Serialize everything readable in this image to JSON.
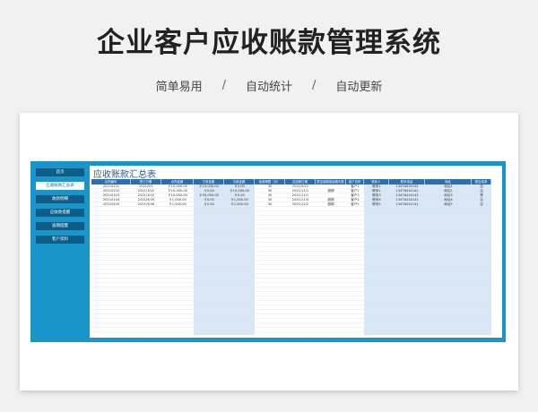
{
  "page": {
    "title": "企业客户应收账款管理系统",
    "subtitle": [
      "简单易用",
      "自动统计",
      "自动更新"
    ],
    "separator": "/"
  },
  "sidebar": {
    "items": [
      {
        "label": "首页",
        "active": false
      },
      {
        "label": "应收账款汇总表",
        "active": true
      },
      {
        "label": "收款明细",
        "active": false
      },
      {
        "label": "应收款提醒",
        "active": false
      },
      {
        "label": "逾期提醒",
        "active": false
      },
      {
        "label": "客户资料",
        "active": false
      }
    ]
  },
  "sheet": {
    "title": "应收账款汇总表",
    "columns": [
      "合同编号",
      "签订日期",
      "合同金额",
      "已收金额",
      "欠款金额",
      "信用期限（天）",
      "应还款日期",
      "是否逾期或逾期天数",
      "客户名称",
      "联系人",
      "联系电话",
      "地址",
      "是否结清"
    ],
    "rows": [
      [
        "20210101",
        "2021/9/1",
        "￥10,000.00",
        "￥10,000.00",
        "￥0.00",
        "30",
        "2021/9/21",
        "",
        "客户1",
        "联系1",
        "13478414144",
        "地址1",
        "否"
      ],
      [
        "20210102",
        "2021/10/2",
        "￥10,000.00",
        "￥0.00",
        "￥10,000.00",
        "30",
        "2021/11/1",
        "超期",
        "客户2",
        "联系2",
        "13478414142",
        "地址2",
        "否"
      ],
      [
        "20210103",
        "2021/10/2",
        "￥10,000.00",
        "￥50,000.00",
        "￥0.00",
        "30",
        "2021/11/1",
        "",
        "客户3",
        "联系3",
        "13478414143",
        "地址3",
        "是"
      ],
      [
        "20210104",
        "2021/9/25",
        "￥1,000.00",
        "￥0.00",
        "￥1,000.00",
        "30",
        "2021/11/3",
        "超期",
        "客户4",
        "联系4",
        "13478414141",
        "地址4",
        "否"
      ],
      [
        "20210105",
        "2021/9/26",
        "￥1,000.00",
        "￥0.00",
        "￥1,000.00",
        "30",
        "2021/12/2",
        "超期",
        "客户5",
        "联系5",
        "13478414141",
        "地址5",
        "否"
      ]
    ]
  },
  "colors": {
    "accent": "#1a95c9",
    "nav": "#0c5d88",
    "header": "#2b6fb1",
    "shade": "#d8e7f6"
  }
}
